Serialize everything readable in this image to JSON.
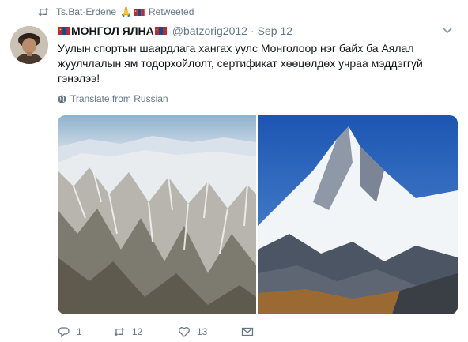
{
  "retweet": {
    "user": "Ts.Bat-Erdene",
    "label": "Retweeted",
    "icon": "retweet-icon",
    "emoji": "🙏"
  },
  "tweet": {
    "display_name": "МОНГОЛ ЯЛНА",
    "screen_name": "@batzorig2012",
    "separator": "·",
    "time": "Sep 12",
    "text": "Уулын спортын шаардлага хангах уулс Монголоор нэг байх ба Аялал\nжуулчлалын ям тодорхойлолт, сертификат хөөцөлдөх учраа мэддэггүй\nгэнэлээ!",
    "translate_label": "Translate from Russian"
  },
  "media": {
    "left_image": "aerial-snow-mountain-ridges",
    "right_image": "snow-peak-everest-blue-sky"
  },
  "actions": {
    "reply_count": "1",
    "retweet_count": "12",
    "like_count": "13"
  },
  "colors": {
    "text": "#14171a",
    "muted": "#657786",
    "flag_red": "#c4272f",
    "flag_blue": "#015197",
    "flag_gold": "#f9cf02"
  }
}
